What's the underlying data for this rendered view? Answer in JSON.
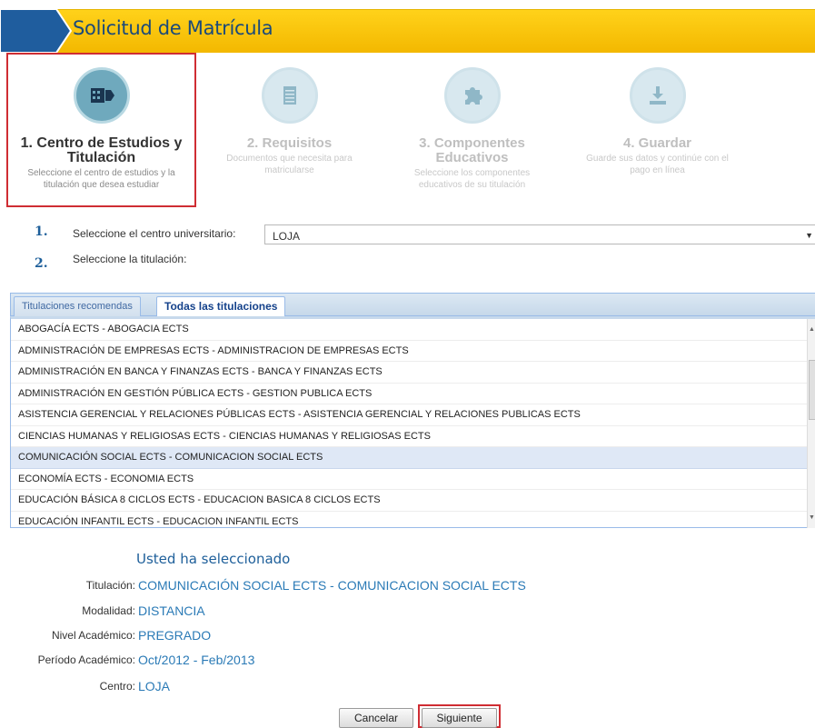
{
  "header": {
    "title": "Solicitud de Matrícula"
  },
  "steps": [
    {
      "title_line1": "1. Centro de Estudios y",
      "title_line2": "Titulación",
      "desc_line1": "Seleccione el centro de estudios y la",
      "desc_line2": "titulación que desea estudiar",
      "icon": "building-icon"
    },
    {
      "title_line1": "2. Requisitos",
      "title_line2": "",
      "desc_line1": "Documentos que necesita para",
      "desc_line2": "matricularse",
      "icon": "document-icon"
    },
    {
      "title_line1": "3. Componentes",
      "title_line2": "Educativos",
      "desc_line1": "Seleccione los componentes",
      "desc_line2": "educativos de su titulación",
      "icon": "puzzle-icon"
    },
    {
      "title_line1": "4. Guardar",
      "title_line2": "",
      "desc_line1": "Guarde sus datos y continúe con el",
      "desc_line2": "pago en línea",
      "icon": "download-icon"
    }
  ],
  "form": {
    "step1_num": "1.",
    "step1_label": "Seleccione el centro universitario:",
    "centro_value": "LOJA",
    "step2_num": "2.",
    "step2_label": "Seleccione la titulación:"
  },
  "tabs": [
    "Titulaciones recomendas",
    "Todas las titulaciones"
  ],
  "titulaciones": [
    "ABOGACÍA ECTS - ABOGACIA ECTS",
    "ADMINISTRACIÓN DE EMPRESAS ECTS - ADMINISTRACION DE EMPRESAS ECTS",
    "ADMINISTRACIÓN EN BANCA Y FINANZAS ECTS - BANCA Y FINANZAS ECTS",
    "ADMINISTRACIÓN EN GESTIÓN PÚBLICA ECTS - GESTION PUBLICA ECTS",
    "ASISTENCIA GERENCIAL Y RELACIONES PÚBLICAS ECTS - ASISTENCIA GERENCIAL Y RELACIONES PUBLICAS ECTS",
    "CIENCIAS HUMANAS Y RELIGIOSAS ECTS - CIENCIAS HUMANAS Y RELIGIOSAS ECTS",
    "COMUNICACIÓN SOCIAL ECTS - COMUNICACION SOCIAL ECTS",
    "ECONOMÍA ECTS - ECONOMIA ECTS",
    "EDUCACIÓN BÁSICA 8 CICLOS ECTS - EDUCACION BASICA 8 CICLOS ECTS",
    "EDUCACIÓN INFANTIL ECTS - EDUCACION INFANTIL ECTS"
  ],
  "selected_index": 6,
  "summary": {
    "title": "Usted ha seleccionado",
    "titulacion_label": "Titulación:",
    "titulacion_value": "COMUNICACIÓN SOCIAL ECTS - COMUNICACION SOCIAL ECTS",
    "modalidad_label": "Modalidad:",
    "modalidad_value": "DISTANCIA",
    "nivel_label": "Nivel Académico:",
    "nivel_value": "PREGRADO",
    "periodo_label": "Período Académico:",
    "periodo_value": "Oct/2012 - Feb/2013",
    "centro_label": "Centro:",
    "centro_value": "LOJA"
  },
  "buttons": {
    "cancel": "Cancelar",
    "next": "Siguiente"
  },
  "colors": {
    "header_yellow": "#f8c80a",
    "header_blue": "#1b4a7a",
    "highlight_red": "#cf2d33",
    "link_blue": "#2a7ab6"
  }
}
